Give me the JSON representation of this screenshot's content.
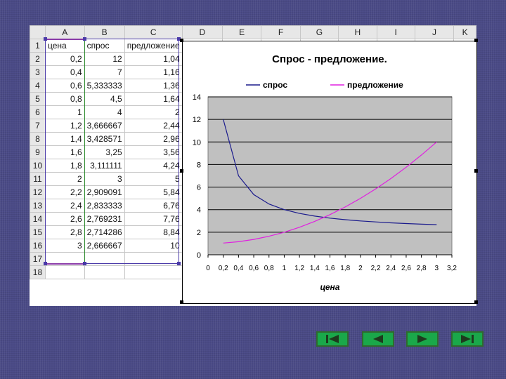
{
  "spreadsheet": {
    "column_headers": [
      "A",
      "B",
      "C",
      "D",
      "E",
      "F",
      "G",
      "H",
      "I",
      "J",
      "K"
    ],
    "row_numbers": [
      "1",
      "2",
      "3",
      "4",
      "5",
      "6",
      "7",
      "8",
      "9",
      "10",
      "11",
      "12",
      "13",
      "14",
      "15",
      "16",
      "17",
      "18"
    ],
    "header_row": [
      "цена",
      "спрос",
      "предложение"
    ],
    "rows": [
      [
        "0,2",
        "12",
        "1,04"
      ],
      [
        "0,4",
        "7",
        "1,16"
      ],
      [
        "0,6",
        "5,333333",
        "1,36"
      ],
      [
        "0,8",
        "4,5",
        "1,64"
      ],
      [
        "1",
        "4",
        "2"
      ],
      [
        "1,2",
        "3,666667",
        "2,44"
      ],
      [
        "1,4",
        "3,428571",
        "2,96"
      ],
      [
        "1,6",
        "3,25",
        "3,56"
      ],
      [
        "1,8",
        "3,111111",
        "4,24"
      ],
      [
        "2",
        "3",
        "5"
      ],
      [
        "2,2",
        "2,909091",
        "5,84"
      ],
      [
        "2,4",
        "2,833333",
        "6,76"
      ],
      [
        "2,6",
        "2,769231",
        "7,76"
      ],
      [
        "2,8",
        "2,714286",
        "8,84"
      ],
      [
        "3",
        "2,666667",
        "10"
      ]
    ]
  },
  "chart_data": {
    "type": "line",
    "title": "Спрос - предложение.",
    "xlabel": "цена",
    "ylabel": "",
    "x": [
      0.2,
      0.4,
      0.6,
      0.8,
      1.0,
      1.2,
      1.4,
      1.6,
      1.8,
      2.0,
      2.2,
      2.4,
      2.6,
      2.8,
      3.0
    ],
    "series": [
      {
        "name": "спрос",
        "color": "#1a1a8c",
        "values": [
          12,
          7,
          5.333333,
          4.5,
          4,
          3.666667,
          3.428571,
          3.25,
          3.111111,
          3,
          2.909091,
          2.833333,
          2.769231,
          2.714286,
          2.666667
        ]
      },
      {
        "name": "предложение",
        "color": "#e020e0",
        "values": [
          1.04,
          1.16,
          1.36,
          1.64,
          2,
          2.44,
          2.96,
          3.56,
          4.24,
          5,
          5.84,
          6.76,
          7.76,
          8.84,
          10
        ]
      }
    ],
    "xlim": [
      0,
      3.2
    ],
    "ylim": [
      0,
      14
    ],
    "x_ticks": [
      "0",
      "0,2",
      "0,4",
      "0,6",
      "0,8",
      "1",
      "1,2",
      "1,4",
      "1,6",
      "1,8",
      "2",
      "2,2",
      "2,4",
      "2,6",
      "2,8",
      "3",
      "3,2"
    ],
    "y_ticks": [
      "0",
      "2",
      "4",
      "6",
      "8",
      "10",
      "12",
      "14"
    ],
    "grid": true,
    "legend_position": "top",
    "plot_background": "#c0c0c0"
  },
  "navigation": {
    "buttons": [
      {
        "name": "first-slide",
        "icon": "skip-back-icon"
      },
      {
        "name": "previous-slide",
        "icon": "triangle-left-icon"
      },
      {
        "name": "next-slide",
        "icon": "triangle-right-icon"
      },
      {
        "name": "last-slide",
        "icon": "skip-forward-icon"
      }
    ]
  }
}
